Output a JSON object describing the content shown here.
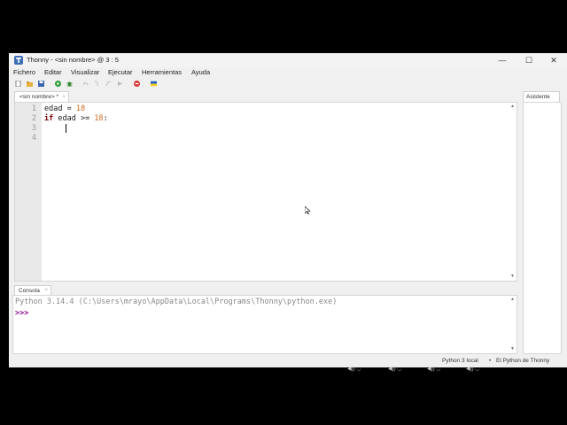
{
  "window": {
    "app_name": "Thonny",
    "title_rest": "- <sin nombre> @ 3 : 5",
    "min_glyph": "—",
    "max_glyph": "☐",
    "close_glyph": "✕"
  },
  "menu": [
    "Fichero",
    "Editar",
    "Visualizar",
    "Ejecutar",
    "Herramientas",
    "Ayuda"
  ],
  "toolbar_icons": [
    "new-file-icon",
    "open-file-icon",
    "save-icon",
    "run-icon",
    "debug-icon",
    "step-over-icon",
    "step-into-icon",
    "step-out-icon",
    "resume-icon",
    "stop-icon",
    "ukraine-flag-icon"
  ],
  "editor": {
    "tab_label": "<sin nombre> *",
    "tab_close": "×",
    "line_numbers": [
      "1",
      "2",
      "3",
      "4"
    ],
    "lines": [
      {
        "var": "edad",
        "op": " = ",
        "num": "18"
      },
      {
        "kw": "if",
        "rest": " edad >= ",
        "num": "18",
        "end": ":"
      }
    ]
  },
  "assistant": {
    "tab_label": "Asistente"
  },
  "console": {
    "tab_label": "Consola",
    "tab_close": "×",
    "banner": "Python 3.14.4 (C:\\Users\\mrayo\\AppData\\Local\\Programs\\Thonny\\python.exe)",
    "prompt": ">>>"
  },
  "status": {
    "interpreter": "Python 3 local",
    "separator": "•",
    "backend": "El Python de Thonny"
  },
  "colors": {
    "keyword": "#7f0000",
    "number": "#d2691e",
    "prompt": "#8b008b",
    "banner": "#888888"
  }
}
